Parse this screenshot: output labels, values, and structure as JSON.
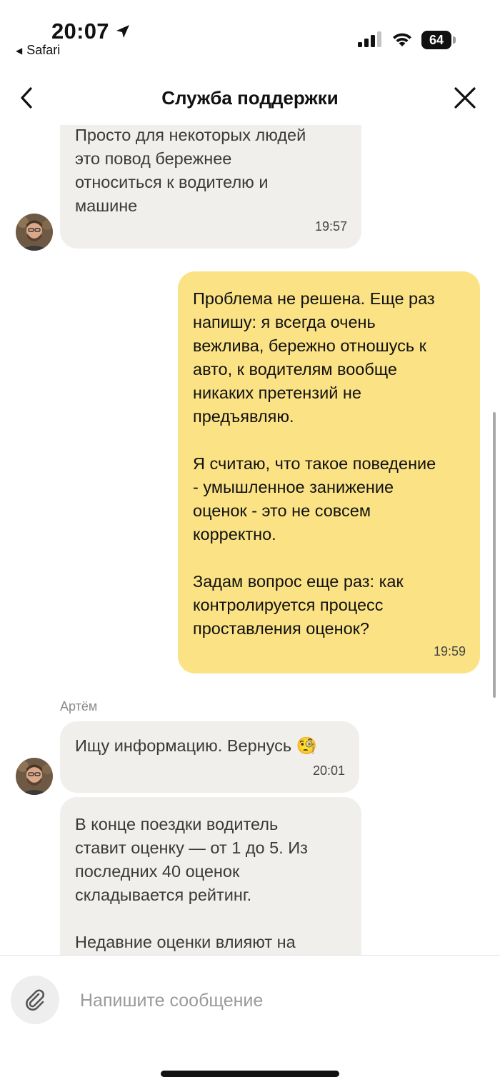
{
  "status_bar": {
    "time": "20:07",
    "back_app": "Safari",
    "battery_level": "64"
  },
  "header": {
    "title": "Служба поддержки"
  },
  "messages": [
    {
      "direction": "incoming",
      "text": "Просто для некоторых людей\nэто повод бережнее\nотноситься к водителю и\nмашине",
      "time": "19:57"
    },
    {
      "direction": "outgoing",
      "text": "Проблема не решена. Еще раз\nнапишу: я всегда очень\nвежлива, бережно отношусь к\nавто, к водителям вообще\nникаких претензий не\nпредъявляю.\n\nЯ считаю, что такое поведение\n- умышленное занижение\nоценок - это не совсем\nкорректно.\n\nЗадам вопрос еще раз: как\nконтролируется процесс\nпроставления оценок?",
      "time": "19:59"
    },
    {
      "direction": "incoming",
      "sender": "Артём",
      "text": "Ищу информацию. Вернусь",
      "emoji": "🧐",
      "time": "20:01"
    },
    {
      "direction": "incoming",
      "text": "В конце поездки водитель\nставит оценку — от 1 до 5. Из\nпоследних 40 оценок\nскладывается рейтинг.\n\nНедавние оценки влияют на"
    }
  ],
  "input": {
    "placeholder": "Напишите сообщение"
  },
  "icons": {
    "back": "chevron-left-icon",
    "close": "close-icon",
    "attach": "paperclip-icon",
    "location": "location-arrow-icon",
    "signal": "cellular-signal-icon",
    "wifi": "wifi-icon"
  },
  "colors": {
    "outgoing_bubble": "#fbe385",
    "incoming_bubble": "#f0efec",
    "time_text": "#444444"
  }
}
